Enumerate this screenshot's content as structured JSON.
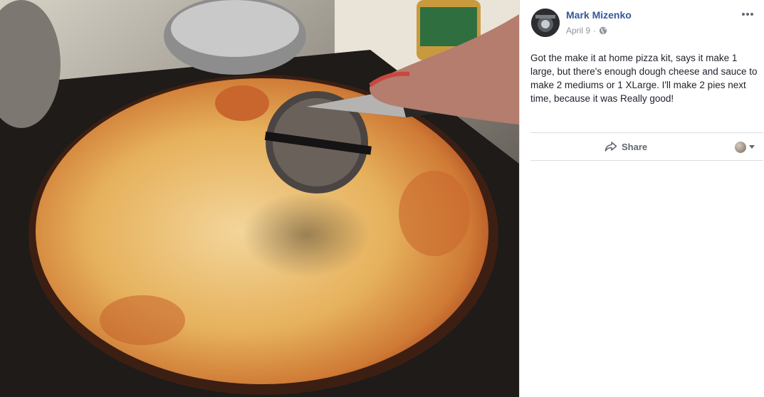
{
  "post": {
    "author": "Mark Mizenko",
    "date": "April 9",
    "separator": "·",
    "privacy_icon": "globe-icon",
    "text": "Got the make it at home pizza kit, says it make 1 large, but there's enough dough cheese and sauce to make 2 mediums or 1 XLarge. I'll make 2 pies next time, because it was Really good!"
  },
  "actions": {
    "share_label": "Share",
    "share_icon": "share-arrow-icon",
    "reactor_menu_icon": "caret-down-icon"
  },
  "colors": {
    "author_link": "#365899",
    "body_text": "#1d2129",
    "meta_text": "#90949c",
    "divider": "#dadde1"
  }
}
